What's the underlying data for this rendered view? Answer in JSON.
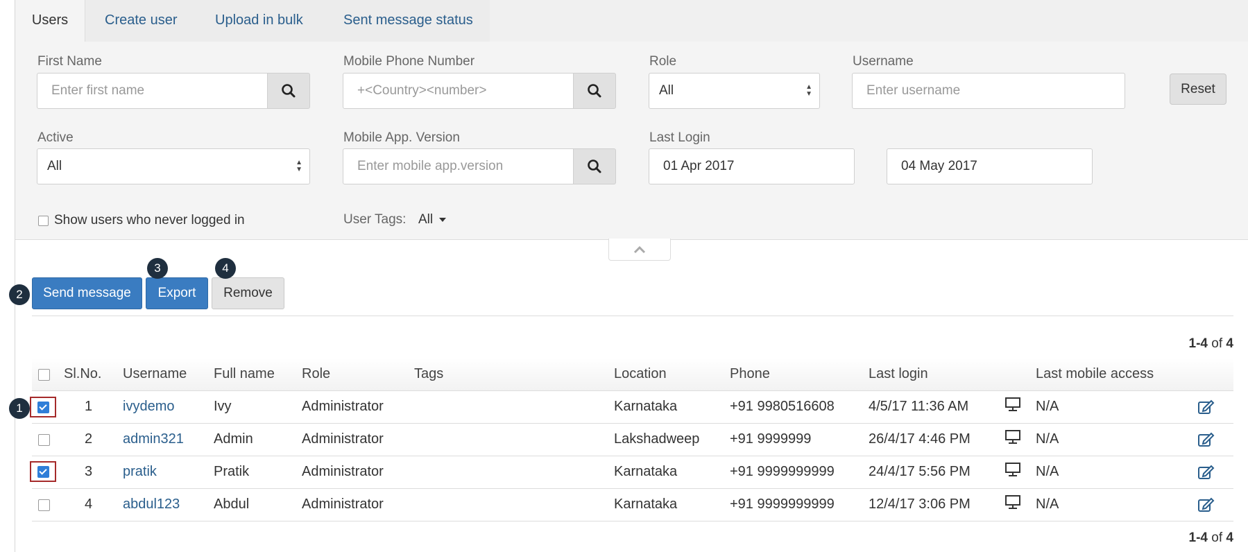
{
  "tabs": [
    "Users",
    "Create user",
    "Upload in bulk",
    "Sent message status"
  ],
  "filters": {
    "first_name": {
      "label": "First Name",
      "placeholder": "Enter first name"
    },
    "mobile": {
      "label": "Mobile Phone Number",
      "placeholder": "+<Country><number>"
    },
    "role": {
      "label": "Role",
      "value": "All"
    },
    "username": {
      "label": "Username",
      "placeholder": "Enter username"
    },
    "reset_label": "Reset",
    "active": {
      "label": "Active",
      "value": "All"
    },
    "app_version": {
      "label": "Mobile App. Version",
      "placeholder": "Enter mobile app.version"
    },
    "last_login": {
      "label": "Last Login",
      "from": "01 Apr 2017",
      "to": "04 May 2017"
    },
    "never_logged_in_label": "Show users who never logged in",
    "user_tags": {
      "label": "User Tags:",
      "value": "All"
    }
  },
  "actions": {
    "send_message": "Send message",
    "export": "Export",
    "remove": "Remove"
  },
  "markers": [
    "1",
    "2",
    "3",
    "4"
  ],
  "pagination": {
    "range": "1-4",
    "of": "of",
    "total": "4"
  },
  "table": {
    "headers": [
      "Sl.No.",
      "Username",
      "Full name",
      "Role",
      "Tags",
      "Location",
      "Phone",
      "Last login",
      "Last mobile access"
    ],
    "rows": [
      {
        "sl": "1",
        "username": "ivydemo",
        "full_name": "Ivy",
        "role": "Administrator",
        "tags": "",
        "location": "Karnataka",
        "phone": "+91 9980516608",
        "last_login": "4/5/17 11:36 AM",
        "last_mobile": "N/A",
        "checked": true
      },
      {
        "sl": "2",
        "username": "admin321",
        "full_name": "Admin",
        "role": "Administrator",
        "tags": "",
        "location": "Lakshadweep",
        "phone": "+91 9999999",
        "last_login": "26/4/17 4:46 PM",
        "last_mobile": "N/A",
        "checked": false
      },
      {
        "sl": "3",
        "username": "pratik",
        "full_name": "Pratik",
        "role": "Administrator",
        "tags": "",
        "location": "Karnataka",
        "phone": "+91 9999999999",
        "last_login": "24/4/17 5:56 PM",
        "last_mobile": "N/A",
        "checked": true
      },
      {
        "sl": "4",
        "username": "abdul123",
        "full_name": "Abdul",
        "role": "Administrator",
        "tags": "",
        "location": "Karnataka",
        "phone": "+91 9999999999",
        "last_login": "12/4/17 3:06 PM",
        "last_mobile": "N/A",
        "checked": false
      }
    ]
  },
  "colors": {
    "accent": "#3a7cc1",
    "link": "#2a5e8c",
    "marker": "#1f2f3f",
    "highlight": "#a52a2a"
  }
}
